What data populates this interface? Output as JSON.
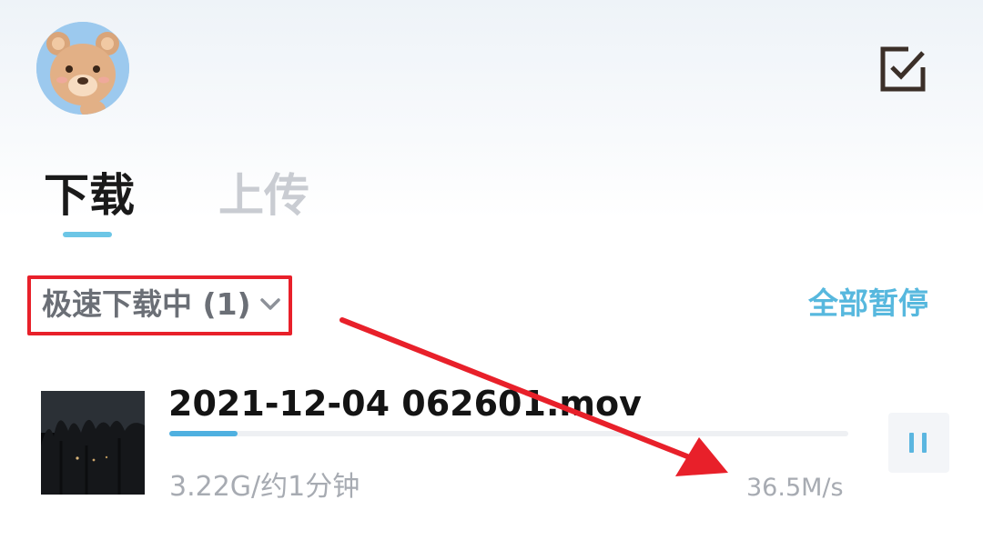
{
  "header": {
    "avatar_icon": "bear-avatar-icon",
    "edit_icon": "checkbox-edit-icon"
  },
  "tabs": [
    {
      "label": "下载",
      "active": true
    },
    {
      "label": "上传",
      "active": false
    }
  ],
  "section": {
    "title": "极速下载中 (1)",
    "chevron_icon": "chevron-down-icon",
    "pause_all_label": "全部暂停"
  },
  "download": {
    "file_name": "2021-12-04 062601.mov",
    "progress": 0.1,
    "meta": "3.22G/约1分钟",
    "speed": "36.5M/s",
    "pause_icon": "pause-icon"
  },
  "colors": {
    "accent": "#57b8de",
    "progress": "#4fb0e0",
    "annotation_red": "#e8202a",
    "tab_inactive": "#c9ccd2"
  }
}
